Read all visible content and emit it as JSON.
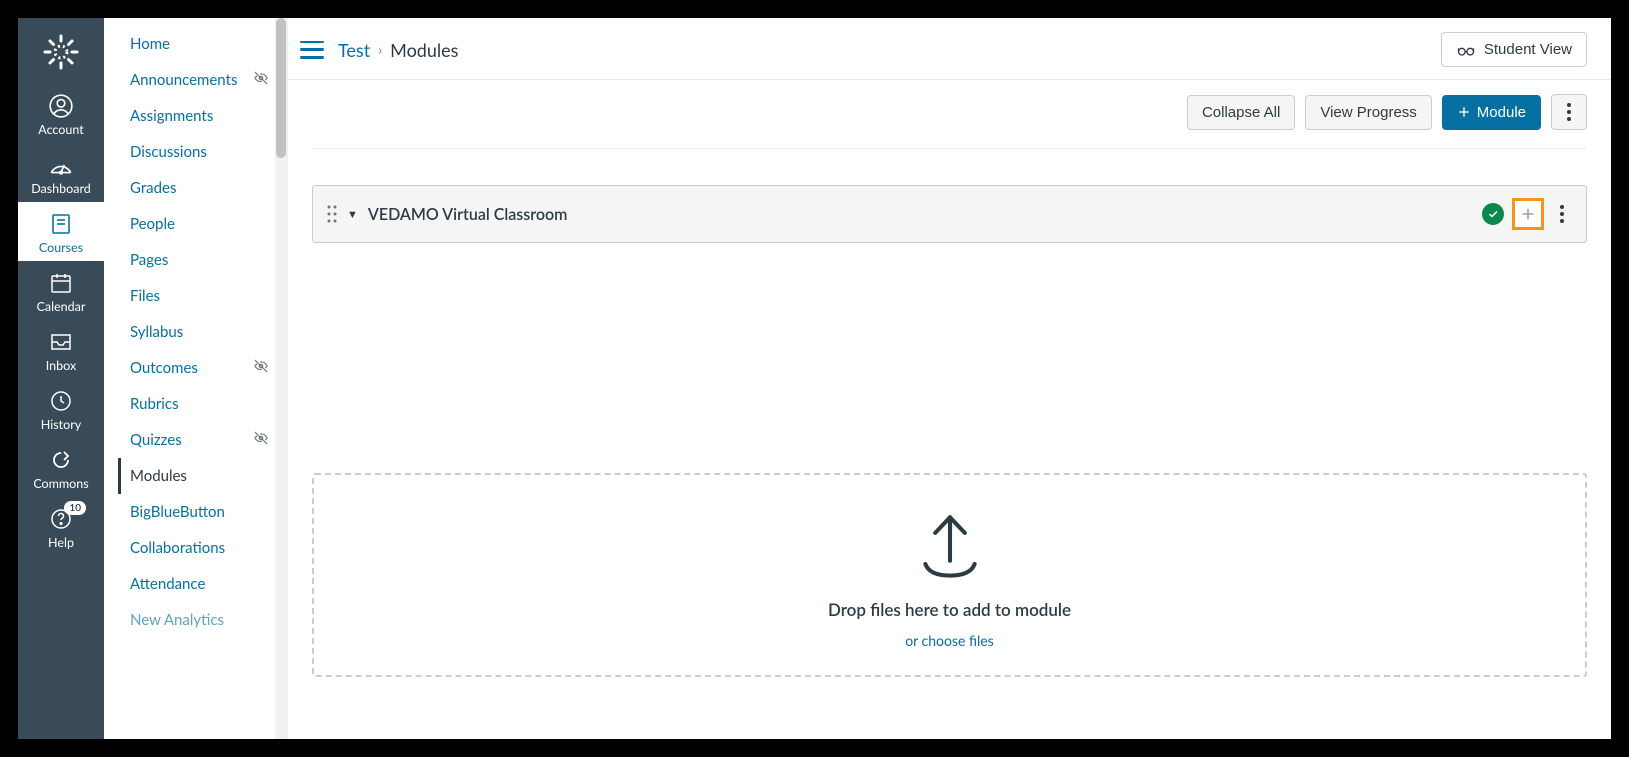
{
  "global_nav": {
    "items": [
      {
        "key": "account",
        "label": "Account"
      },
      {
        "key": "dashboard",
        "label": "Dashboard"
      },
      {
        "key": "courses",
        "label": "Courses"
      },
      {
        "key": "calendar",
        "label": "Calendar"
      },
      {
        "key": "inbox",
        "label": "Inbox"
      },
      {
        "key": "history",
        "label": "History"
      },
      {
        "key": "commons",
        "label": "Commons"
      },
      {
        "key": "help",
        "label": "Help",
        "badge": "10"
      }
    ]
  },
  "course_nav": {
    "items": [
      {
        "label": "Home"
      },
      {
        "label": "Announcements",
        "hidden": true
      },
      {
        "label": "Assignments"
      },
      {
        "label": "Discussions"
      },
      {
        "label": "Grades"
      },
      {
        "label": "People"
      },
      {
        "label": "Pages"
      },
      {
        "label": "Files"
      },
      {
        "label": "Syllabus"
      },
      {
        "label": "Outcomes",
        "hidden": true
      },
      {
        "label": "Rubrics"
      },
      {
        "label": "Quizzes",
        "hidden": true
      },
      {
        "label": "Modules",
        "active": true
      },
      {
        "label": "BigBlueButton"
      },
      {
        "label": "Collaborations"
      },
      {
        "label": "Attendance"
      },
      {
        "label": "New Analytics"
      }
    ]
  },
  "breadcrumb": {
    "course": "Test",
    "page": "Modules"
  },
  "topbar": {
    "student_view": "Student View"
  },
  "actions": {
    "collapse": "Collapse All",
    "progress": "View Progress",
    "add": "Module"
  },
  "module": {
    "title": "VEDAMO Virtual Classroom"
  },
  "dropzone": {
    "title": "Drop files here to add to module",
    "link": "or choose files"
  }
}
